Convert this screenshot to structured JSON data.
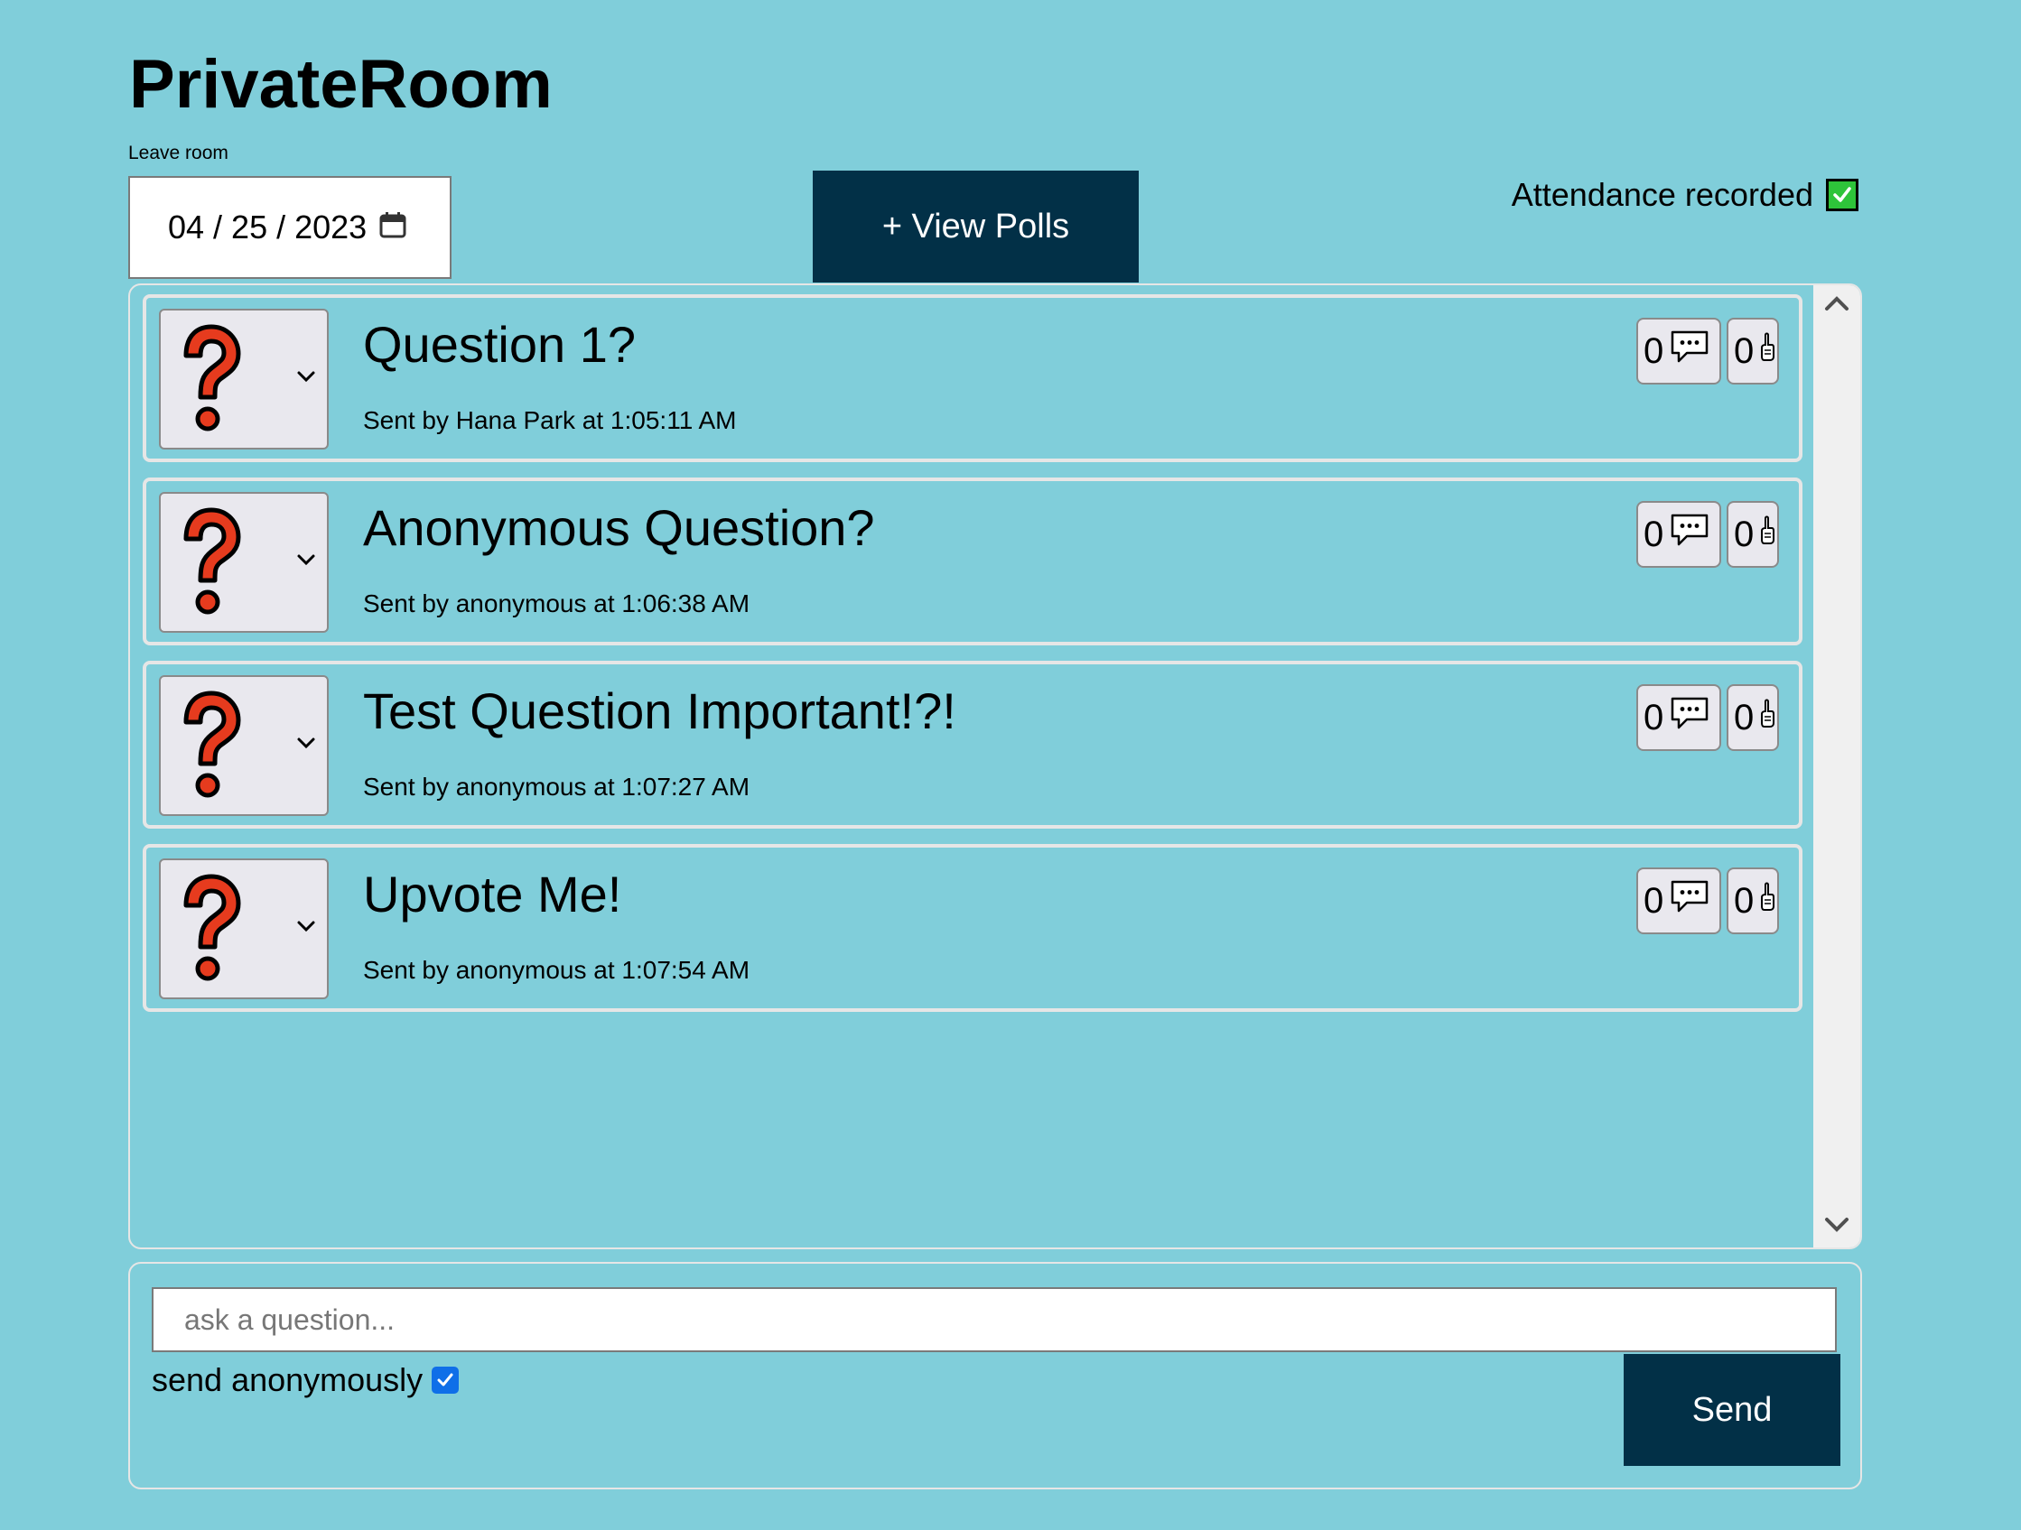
{
  "room": {
    "title": "PrivateRoom",
    "leave_label": "Leave room"
  },
  "date": {
    "value": "04 / 25 / 2023"
  },
  "polls_button": "+ View Polls",
  "attendance": {
    "label": "Attendance recorded",
    "checked": true
  },
  "questions": [
    {
      "title": "Question 1?",
      "sender": "Sent by Hana Park at 1:05:11 AM",
      "comments": "0",
      "upvotes": "0"
    },
    {
      "title": "Anonymous Question?",
      "sender": "Sent by anonymous at 1:06:38 AM",
      "comments": "0",
      "upvotes": "0"
    },
    {
      "title": "Test Question Important!?!",
      "sender": "Sent by anonymous at 1:07:27 AM",
      "comments": "0",
      "upvotes": "0"
    },
    {
      "title": "Upvote Me!",
      "sender": "Sent by anonymous at 1:07:54 AM",
      "comments": "0",
      "upvotes": "0"
    }
  ],
  "compose": {
    "placeholder": "ask a question...",
    "anonymous_label": "send anonymously",
    "anonymous_checked": true,
    "send_label": "Send"
  },
  "icons": {
    "question": "question-mark-icon",
    "comment": "speech-bubble-icon",
    "upvote": "hand-pointing-up-icon",
    "calendar": "calendar-icon"
  },
  "colors": {
    "background": "#80ceda",
    "button": "#023047",
    "question_mark": "#e63b1e",
    "attendance_check": "#2ec43a",
    "checkbox": "#0f6fe8"
  }
}
